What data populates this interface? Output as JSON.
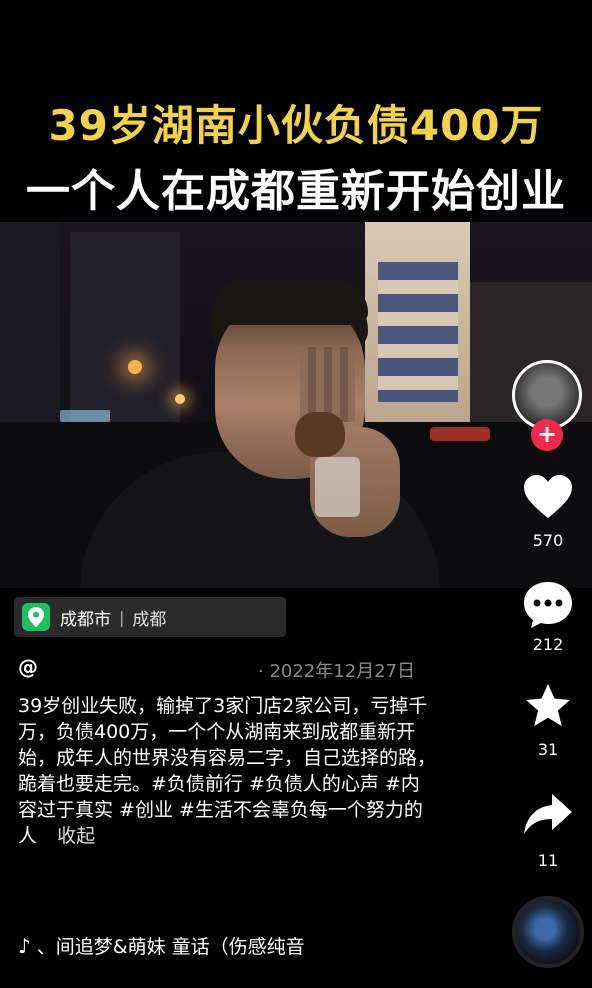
{
  "banner": {
    "title_line1": "39岁湖南小伙负债400万",
    "title_line2": "一个人在成都重新开始创业"
  },
  "location": {
    "city": "成都市",
    "place": "成都"
  },
  "post": {
    "username": "@",
    "date": "· 2022年12月27日",
    "caption": "39岁创业失败，输掉了3家门店2家公司，亏掉千万，负债400万，一个个从湖南来到成都重新开始，成年人的世界没有容易二字，自己选择的路，跪着也要走完。#负债前行 #负债人的心声 #内容过于真实 #创业 #生活不会辜负每一个努力的人",
    "collapse_label": "收起",
    "music": "、间追梦&萌妹   童话（伤感纯音"
  },
  "rail": {
    "like_count": "570",
    "comment_count": "212",
    "favorite_count": "31",
    "share_count": "11",
    "follow_label": "+"
  },
  "colors": {
    "title_yellow": "#f2d24a",
    "accent_red": "#f02a4a",
    "location_green": "#1fbf5f"
  },
  "icons": [
    "location-pin-icon",
    "heart-icon",
    "comment-icon",
    "star-icon",
    "share-icon",
    "music-note-icon"
  ]
}
